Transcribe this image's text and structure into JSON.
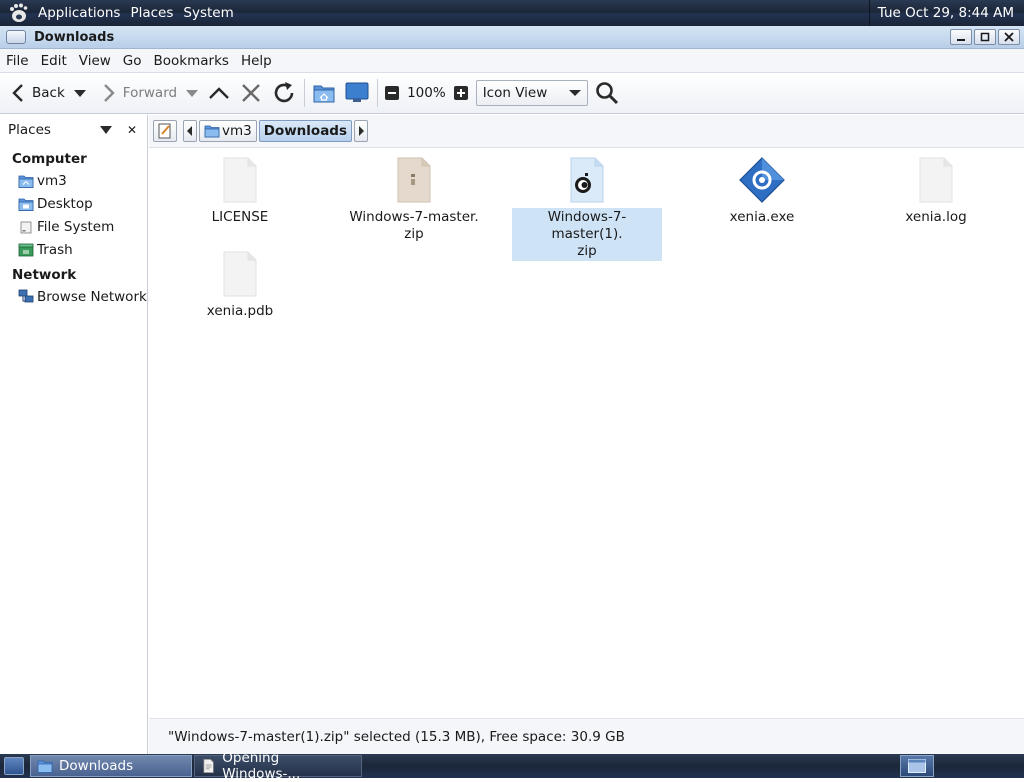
{
  "top_panel": {
    "menus": [
      "Applications",
      "Places",
      "System"
    ],
    "clock": "Tue Oct 29,  8:44 AM"
  },
  "window": {
    "title": "Downloads"
  },
  "menubar": [
    "File",
    "Edit",
    "View",
    "Go",
    "Bookmarks",
    "Help"
  ],
  "toolbar": {
    "back_label": "Back",
    "forward_label": "Forward",
    "zoom_level": "100%",
    "view_mode": "Icon View"
  },
  "sidebar": {
    "title": "Places",
    "close_glyph": "✕",
    "sections": [
      {
        "label": "Computer",
        "items": [
          {
            "label": "vm3",
            "icon": "home-folder-icon"
          },
          {
            "label": "Desktop",
            "icon": "desktop-icon"
          },
          {
            "label": "File System",
            "icon": "drive-icon"
          },
          {
            "label": "Trash",
            "icon": "trash-icon"
          }
        ]
      },
      {
        "label": "Network",
        "items": [
          {
            "label": "Browse Network",
            "icon": "network-icon"
          }
        ]
      }
    ]
  },
  "location": {
    "crumbs": [
      "vm3",
      "Downloads"
    ],
    "active_crumb": "Downloads"
  },
  "files": [
    {
      "name": "LICENSE",
      "icon": "text-file-icon",
      "selected": false
    },
    {
      "name": "Windows-7-master.\nzip",
      "icon": "zip-archive-icon",
      "selected": false
    },
    {
      "name": "Windows-7-master(1).\nzip",
      "icon": "media-file-icon",
      "selected": true
    },
    {
      "name": "xenia.exe",
      "icon": "executable-icon",
      "selected": false
    },
    {
      "name": "xenia.log",
      "icon": "text-file-icon",
      "selected": false
    },
    {
      "name": "xenia.pdb",
      "icon": "text-file-icon",
      "selected": false
    }
  ],
  "status": {
    "text": "\"Windows-7-master(1).zip\" selected (15.3 MB), Free space: 30.9 GB"
  },
  "taskbar": {
    "tasks": [
      {
        "label": "Downloads",
        "active": true
      },
      {
        "label": "Opening Windows-...",
        "active": false
      }
    ]
  },
  "colors": {
    "panel": "#1b2638",
    "selection": "#cfe3f7",
    "titlebar": "#c7daee",
    "folder_blue": "#4a86d4"
  }
}
